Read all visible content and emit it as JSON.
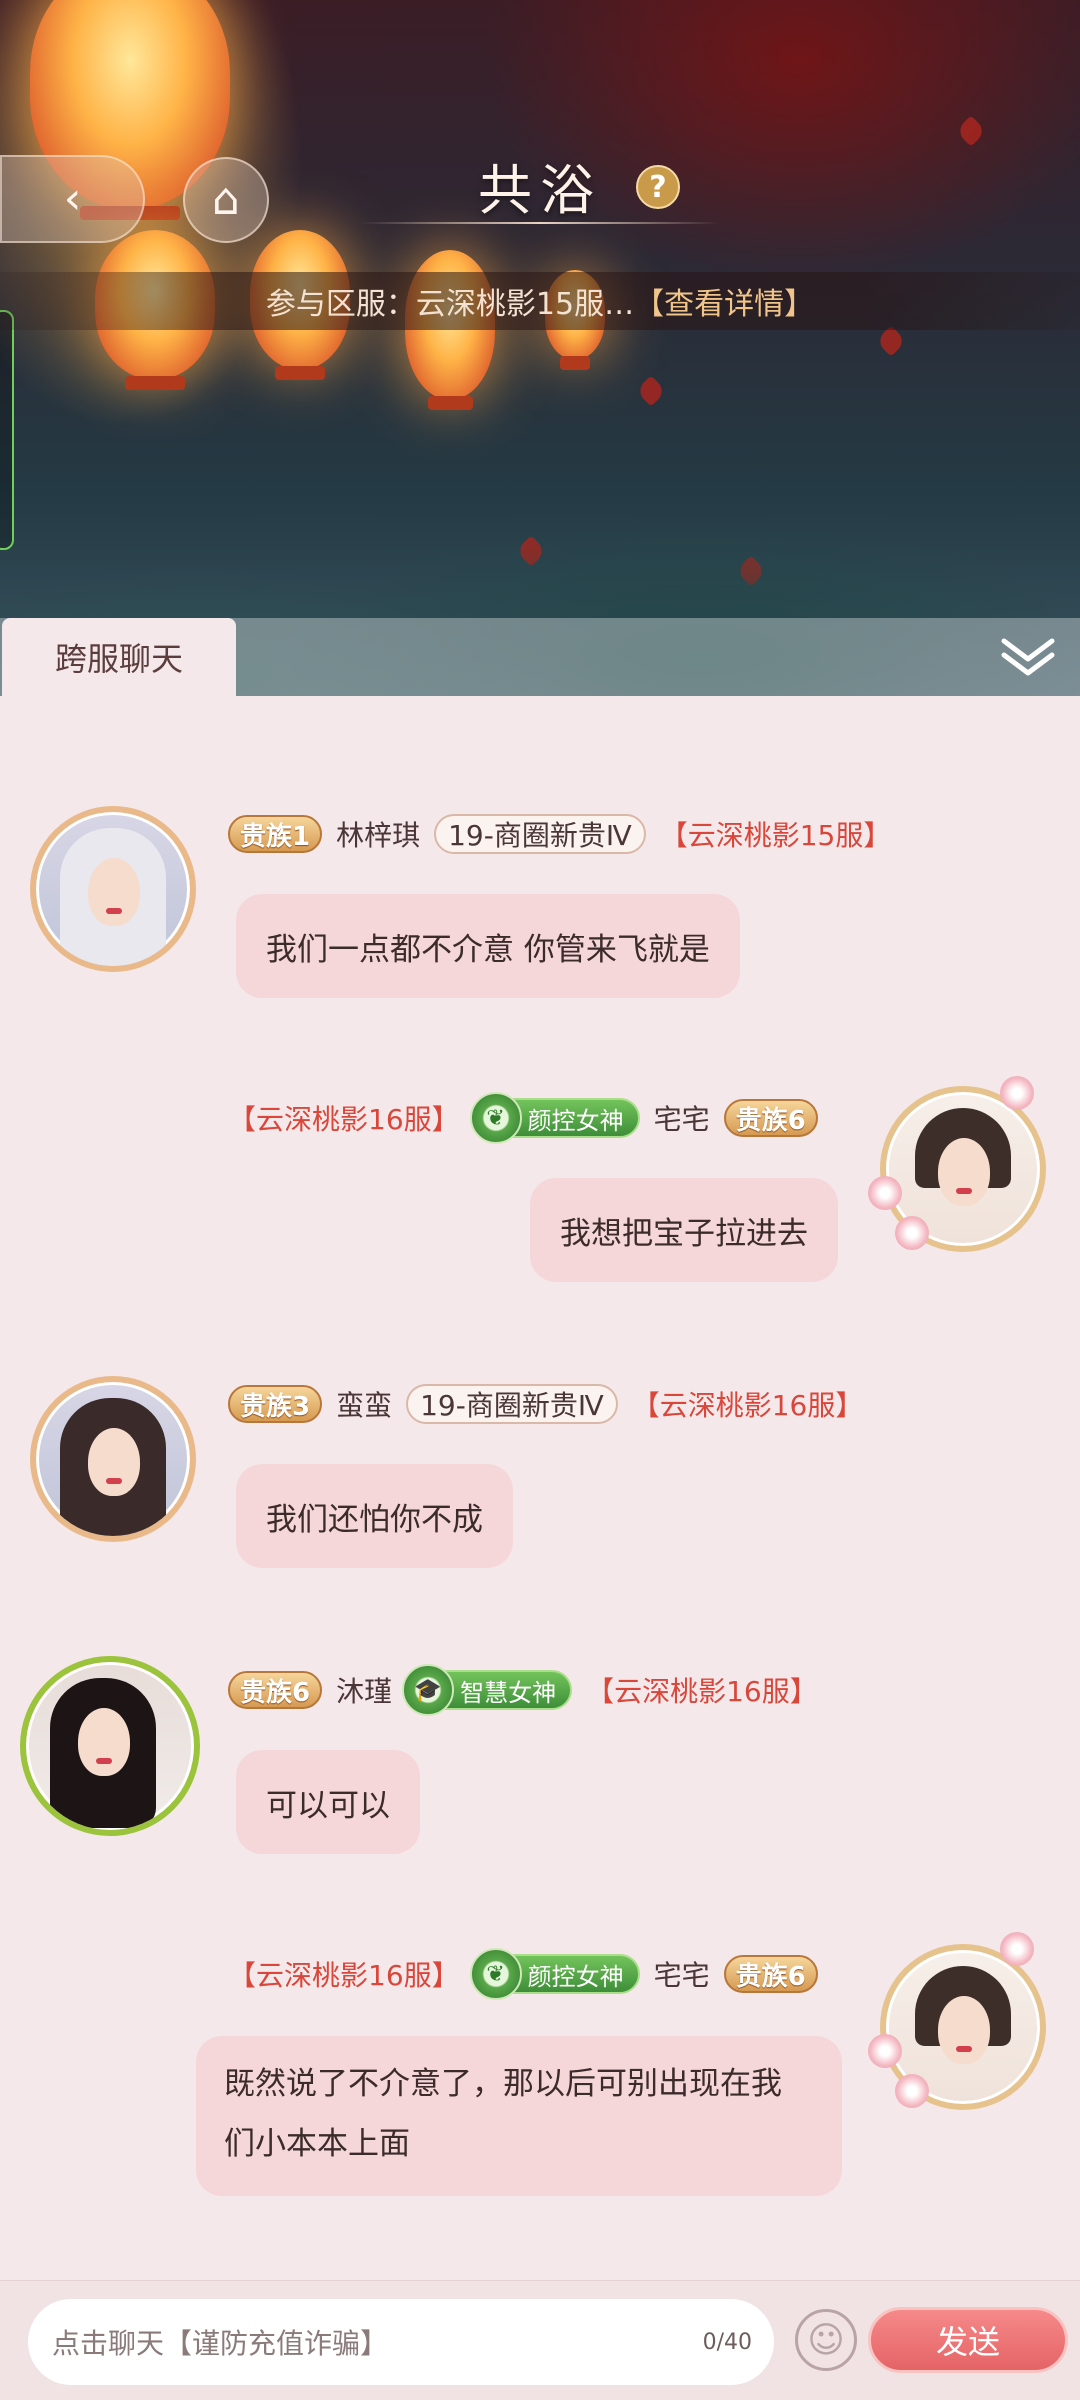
{
  "header": {
    "back_icon": "back-arrow-icon",
    "home_icon": "home-icon",
    "title": "共浴",
    "help_label": "?",
    "server_prefix": "参与区服：云深桃影15服…",
    "server_detail": "【查看详情】"
  },
  "tabs": {
    "active": "跨服聊天",
    "collapse_icon": "double-chevron-down-icon"
  },
  "messages": [
    {
      "side": "left",
      "rank": "贵族1",
      "name": "林梓琪",
      "guild": "19-商圈新贵Ⅳ",
      "server": "【云深桃影15服】",
      "text": "我们一点都不介意 你管来飞就是"
    },
    {
      "side": "right",
      "rank": "贵族6",
      "name": "宅宅",
      "title": "颜控女神",
      "server": "【云深桃影16服】",
      "text": "我想把宝子拉进去"
    },
    {
      "side": "left",
      "rank": "贵族3",
      "name": "蛮蛮",
      "guild": "19-商圈新贵Ⅳ",
      "server": "【云深桃影16服】",
      "text": "我们还怕你不成"
    },
    {
      "side": "left",
      "rank": "贵族6",
      "name": "沐瑾",
      "title": "智慧女神",
      "server": "【云深桃影16服】",
      "text": "可以可以"
    },
    {
      "side": "right",
      "rank": "贵族6",
      "name": "宅宅",
      "title": "颜控女神",
      "server": "【云深桃影16服】",
      "text_line1": "既然说了不介意了，那以后可别出现在我",
      "text_line2": "们小本本上面"
    }
  ],
  "input": {
    "placeholder": "点击聊天【谨防充值诈骗】",
    "counter": "0/40",
    "emoji_icon": "smiley-icon",
    "send_label": "发送"
  },
  "colors": {
    "bubble": "#f5d7da",
    "server_text": "#d9473b",
    "send_button": "#e56466",
    "chat_bg": "#f5e8ea"
  }
}
